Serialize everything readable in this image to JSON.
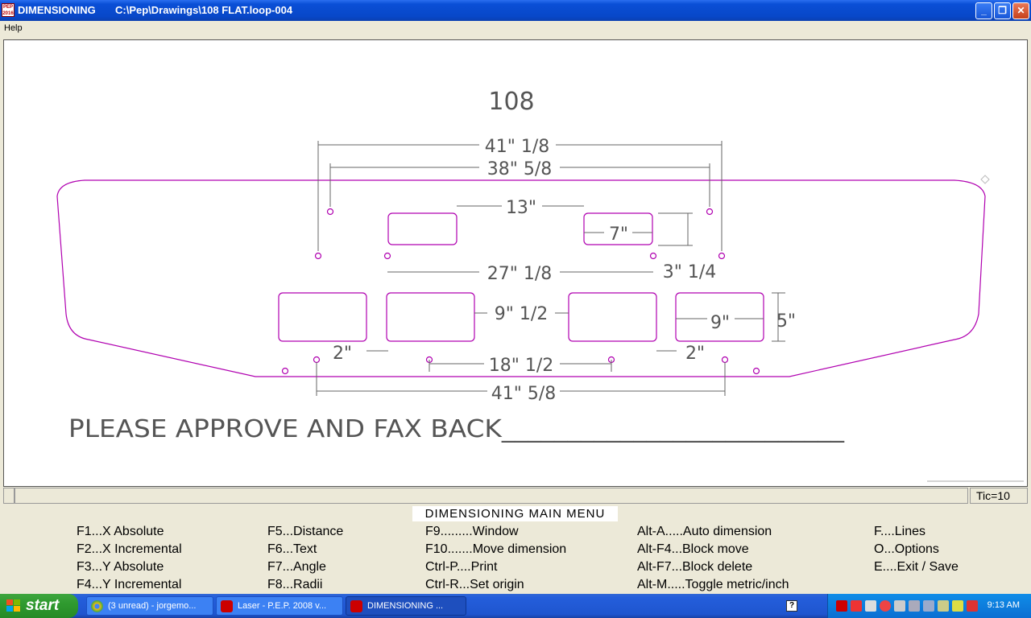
{
  "window": {
    "app_name": "DIMENSIONING",
    "file_path": "C:\\Pep\\Drawings\\108 FLAT.loop-004",
    "minimize_label": "_",
    "restore_label": "❐",
    "close_label": "✕"
  },
  "menubar": {
    "help_label": "Help"
  },
  "drawing": {
    "part_number": "108",
    "dims": {
      "d41_1_8": "41\" 1/8",
      "d38_5_8": "38\" 5/8",
      "d13": "13\"",
      "d7": "7\"",
      "d27_1_8": "27\" 1/8",
      "d3_1_4": "3\" 1/4",
      "d9_1_2": "9\" 1/2",
      "d9": "9\"",
      "d5": "5\"",
      "d2_left": "2\"",
      "d2_right": "2\"",
      "d18_1_2": "18\" 1/2",
      "d41_5_8": "41\" 5/8"
    },
    "approval_text": "PLEASE APPROVE AND FAX BACK__________________________",
    "line_color": "#b000b0",
    "dim_color": "#555555"
  },
  "status": {
    "tic": "Tic=10"
  },
  "main_menu": {
    "title": "DIMENSIONING MAIN MENU",
    "col1": [
      "F1...X Absolute",
      "F2...X Incremental",
      "F3...Y Absolute",
      "F4...Y Incremental"
    ],
    "col2": [
      "F5...Distance",
      "F6...Text",
      "F7...Angle",
      "F8...Radii"
    ],
    "col3": [
      "F9.........Window",
      "F10.......Move dimension",
      "Ctrl-P....Print",
      "Ctrl-R...Set origin"
    ],
    "col4": [
      "Alt-A.....Auto dimension",
      "Alt-F4...Block move",
      "Alt-F7...Block delete",
      "Alt-M.....Toggle metric/inch"
    ],
    "col5": [
      "F....Lines",
      "O...Options",
      "E....Exit / Save"
    ]
  },
  "taskbar": {
    "start_label": "start",
    "tasks": [
      {
        "label": "(3 unread) - jorgemo...",
        "icon": "chrome-icon"
      },
      {
        "label": "Laser - P.E.P. 2008 v...",
        "icon": "pep-icon"
      },
      {
        "label": "DIMENSIONING        ...",
        "icon": "pep-icon"
      }
    ],
    "clock": "9:13 AM"
  }
}
